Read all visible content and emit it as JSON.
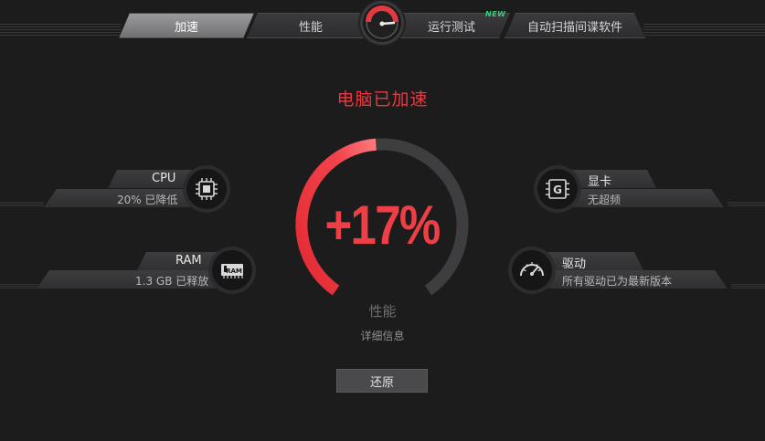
{
  "nav": {
    "tabs": [
      {
        "label": "加速",
        "active": true
      },
      {
        "label": "性能",
        "active": false
      },
      {
        "label": "运行测试",
        "active": false
      },
      {
        "label": "自动扫描间谍软件",
        "active": false
      }
    ],
    "new_badge": "NEW"
  },
  "status": {
    "title": "电脑已加速"
  },
  "gauge": {
    "value_text": "+17%",
    "percent": 17,
    "label": "性能",
    "details_link": "详细信息"
  },
  "cards": {
    "cpu": {
      "title": "CPU",
      "detail": "20% 已降低",
      "icon_label": "cpu-chip"
    },
    "ram": {
      "title": "RAM",
      "detail": "1.3 GB 已释放",
      "icon_label": "RAM"
    },
    "gpu": {
      "title": "显卡",
      "detail": "无超频",
      "icon_label": "G"
    },
    "driver": {
      "title": "驱动",
      "detail": "所有驱动已为最新版本",
      "icon_label": "speedometer"
    }
  },
  "actions": {
    "restore_label": "还原"
  },
  "colors": {
    "accent_red": "#e8393f",
    "gauge_red": "#ef3f46",
    "new_green": "#36d27a",
    "background": "#1c1c1d"
  }
}
